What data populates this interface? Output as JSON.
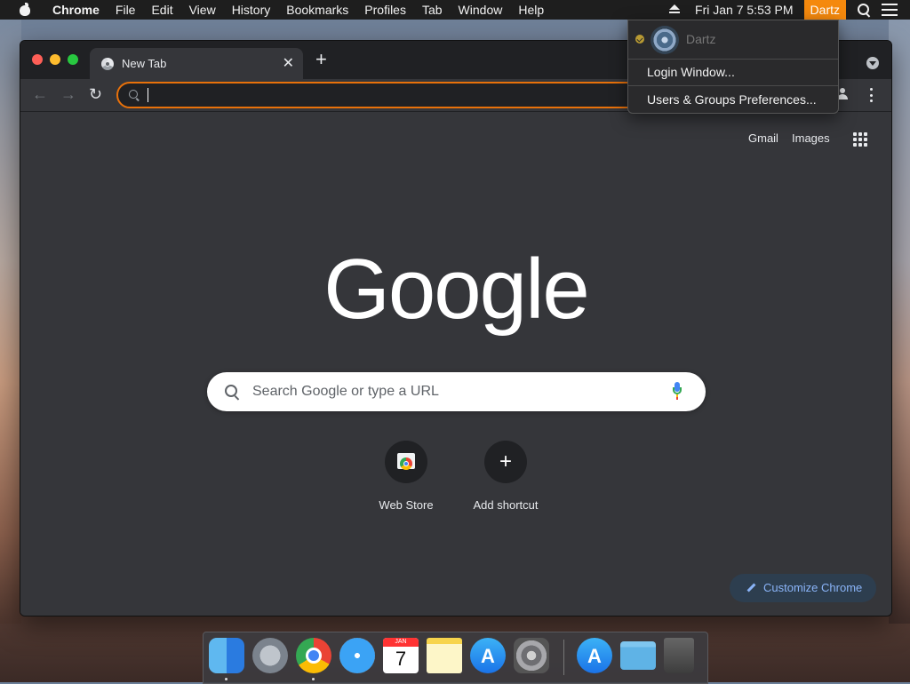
{
  "menubar": {
    "app_name": "Chrome",
    "items": [
      "File",
      "Edit",
      "View",
      "History",
      "Bookmarks",
      "Profiles",
      "Tab",
      "Window",
      "Help"
    ],
    "clock": "Fri Jan 7  5:53 PM",
    "user": "Dartz"
  },
  "user_menu": {
    "current_user": "Dartz",
    "items": [
      "Login Window...",
      "Users & Groups Preferences..."
    ]
  },
  "browser": {
    "tab_title": "New Tab",
    "omnibox_value": "",
    "top_links": {
      "gmail": "Gmail",
      "images": "Images"
    },
    "logo_text": "Google",
    "search_placeholder": "Search Google or type a URL",
    "shortcuts": [
      {
        "label": "Web Store",
        "icon": "web-store-icon"
      },
      {
        "label": "Add shortcut",
        "icon": "plus-icon"
      }
    ],
    "customize_label": "Customize Chrome"
  },
  "dock": {
    "apps": [
      "finder",
      "launchpad",
      "chrome",
      "safari",
      "calendar",
      "notes",
      "app-store",
      "system-preferences",
      "app-store",
      "downloads-folder",
      "trash"
    ],
    "calendar_month": "JAN",
    "calendar_day": "7"
  },
  "colors": {
    "accent_orange": "#e8710a",
    "menubar_highlight": "#f5890d",
    "ntp_background": "#35363a",
    "link_blue": "#8ab4f8"
  }
}
